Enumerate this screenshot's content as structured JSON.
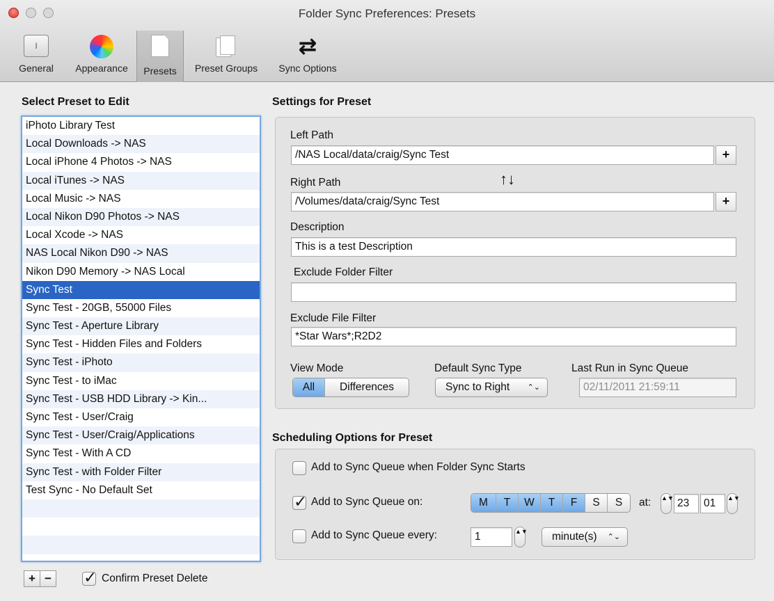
{
  "window": {
    "title": "Folder Sync Preferences: Presets"
  },
  "toolbar": {
    "items": [
      {
        "label": "General",
        "icon": "switch-icon"
      },
      {
        "label": "Appearance",
        "icon": "color-wheel-icon"
      },
      {
        "label": "Presets",
        "icon": "document-icon",
        "selected": true
      },
      {
        "label": "Preset Groups",
        "icon": "documents-icon"
      },
      {
        "label": "Sync Options",
        "icon": "sync-arrows-icon"
      }
    ],
    "general_icon_text": "I"
  },
  "presets": {
    "title": "Select Preset to Edit",
    "items": [
      "iPhoto Library Test",
      "Local Downloads -> NAS",
      "Local iPhone 4 Photos -> NAS",
      "Local iTunes -> NAS",
      "Local Music -> NAS",
      "Local Nikon D90 Photos -> NAS",
      "Local Xcode -> NAS",
      "NAS Local Nikon D90 -> NAS",
      "Nikon D90 Memory -> NAS Local",
      "Sync Test",
      "Sync Test - 20GB, 55000 Files",
      "Sync Test - Aperture Library",
      "Sync Test - Hidden Files and Folders",
      "Sync Test - iPhoto",
      "Sync Test - to iMac",
      "Sync Test - USB HDD Library -> Kin...",
      "Sync Test - User/Craig",
      "Sync Test - User/Craig/Applications",
      "Sync Test - With A CD",
      "Sync Test - with Folder Filter",
      "Test Sync - No Default Set"
    ],
    "selected_index": 9,
    "add_label": "+",
    "remove_label": "−",
    "confirm_delete_label": "Confirm Preset Delete",
    "confirm_delete_checked": true
  },
  "settings": {
    "title": "Settings for Preset",
    "left_path_label": "Left Path",
    "left_path": "/NAS Local/data/craig/Sync Test",
    "right_path_label": "Right Path",
    "right_path": "/Volumes/data/craig/Sync Test",
    "swap_symbol": "↑↓",
    "add_symbol": "+",
    "description_label": "Description",
    "description": "This is a test Description",
    "exclude_folder_label": "Exclude Folder Filter",
    "exclude_folder": "",
    "exclude_file_label": "Exclude File Filter",
    "exclude_file": "*Star Wars*;R2D2",
    "view_mode_label": "View Mode",
    "view_mode_all": "All",
    "view_mode_diff": "Differences",
    "default_sync_label": "Default Sync Type",
    "default_sync_value": "Sync to Right",
    "popup_arrows": "⌃⌄",
    "last_run_label": "Last Run in Sync Queue",
    "last_run_value": "02/11/2011 21:59:11"
  },
  "scheduling": {
    "title": "Scheduling Options for Preset",
    "on_start_label": "Add to Sync Queue when Folder Sync Starts",
    "on_start_checked": false,
    "on_days_label": "Add to Sync Queue on:",
    "on_days_checked": true,
    "days": [
      {
        "label": "M",
        "on": true
      },
      {
        "label": "T",
        "on": true
      },
      {
        "label": "W",
        "on": true
      },
      {
        "label": "T",
        "on": true
      },
      {
        "label": "F",
        "on": true
      },
      {
        "label": "S",
        "on": false
      },
      {
        "label": "S",
        "on": false
      }
    ],
    "at_label": "at:",
    "hour": "23",
    "minute": "01",
    "every_label": "Add to Sync Queue every:",
    "every_checked": false,
    "every_value": "1",
    "every_unit": "minute(s)",
    "stepper_symbol": "▲▼"
  },
  "colors": {
    "selection": "#2a64c5",
    "segment_on": "#8ebeee",
    "list_border": "#7aa7dc"
  }
}
